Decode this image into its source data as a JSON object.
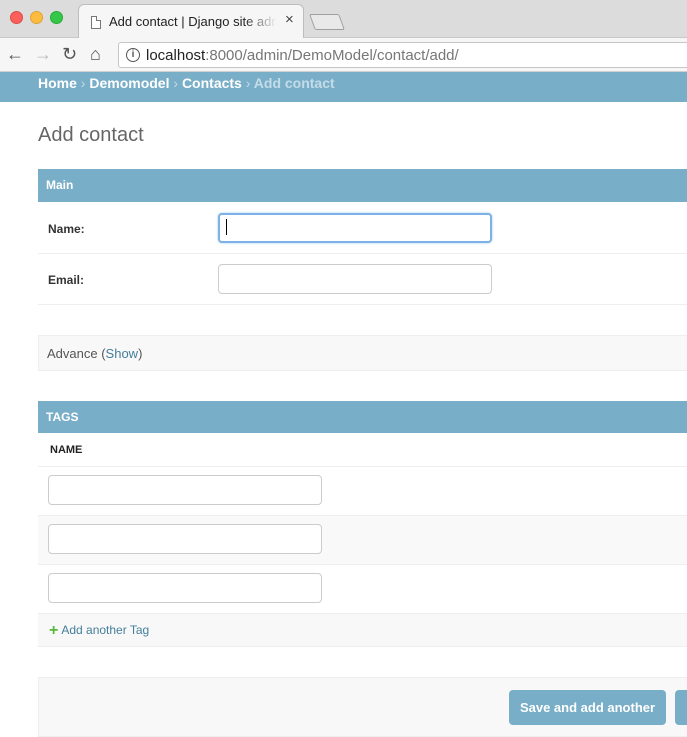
{
  "browser": {
    "tab_title": "Add contact | Django site admin",
    "tab_close": "×",
    "url_host": "localhost",
    "url_rest": ":8000/admin/DemoModel/contact/add/",
    "icons": [
      "back-icon",
      "forward-icon",
      "reload-icon",
      "home-icon",
      "info-icon"
    ]
  },
  "breadcrumbs": {
    "home": "Home",
    "app": "Demomodel",
    "model": "Contacts",
    "current": "Add contact",
    "separator": "›"
  },
  "page": {
    "title": "Add contact"
  },
  "fieldsets": {
    "main": {
      "title": "Main",
      "fields": [
        {
          "label": "Name:",
          "value": "",
          "focused": true
        },
        {
          "label": "Email:",
          "value": ""
        }
      ]
    },
    "advance": {
      "title": "Advance",
      "toggle": "Show"
    }
  },
  "inline": {
    "title": "TAGS",
    "column": "NAME",
    "rows": [
      "",
      "",
      ""
    ],
    "add_label": "Add another Tag"
  },
  "submit": {
    "save_add_another": "Save and add another"
  },
  "colors": {
    "header": "#79aec8",
    "link": "#447e9b",
    "add_icon": "#5ab73b"
  }
}
